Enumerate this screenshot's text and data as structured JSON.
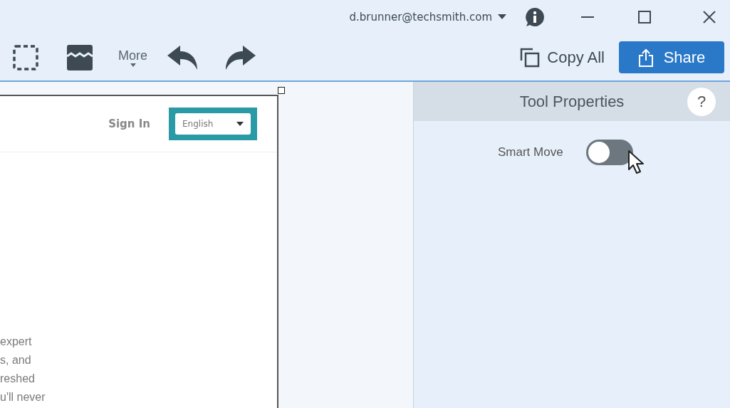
{
  "title_bar": {
    "account": "d.brunner@techsmith.com"
  },
  "toolbar": {
    "more": "More",
    "copy_all": "Copy All",
    "share": "Share"
  },
  "canvas": {
    "page": {
      "sign_in": "Sign In",
      "language": "English",
      "text_lines": [
        "expert",
        "s, and",
        "reshed",
        "u'll never"
      ]
    }
  },
  "properties_panel": {
    "title": "Tool Properties",
    "help": "?",
    "settings": [
      {
        "label": "Smart Move",
        "on": false
      }
    ]
  }
}
